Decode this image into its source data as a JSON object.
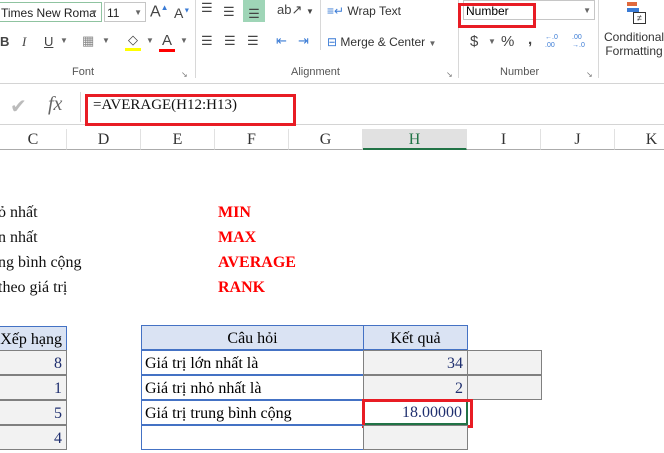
{
  "ribbon": {
    "font_name": "Times New Roma",
    "font_size": "11",
    "bold": "B",
    "italic": "I",
    "underline": "U",
    "font_group": "Font",
    "alignment_group": "Alignment",
    "number_group": "Number",
    "wrap_text": "Wrap Text",
    "merge_center": "Merge & Center",
    "number_format": "Number",
    "currency": "$",
    "percent": "%",
    "comma": ",",
    "increase_decimal": "←.0 .00",
    "decrease_decimal": ".00 →.0",
    "conditional_formatting_1": "Conditional",
    "conditional_formatting_2": "Formatting",
    "colors": {
      "highlight": "#ffff00",
      "font_color": "#ff0000",
      "accent": "#217346"
    }
  },
  "formula_bar": {
    "fx": "fx",
    "formula": "=AVERAGE(H12:H13)"
  },
  "columns": [
    "C",
    "D",
    "E",
    "F",
    "G",
    "H",
    "I",
    "J",
    "K"
  ],
  "notes": [
    {
      "text": "ỏ nhất",
      "func": "MIN"
    },
    {
      "text": "n nhất",
      "func": "MAX"
    },
    {
      "text": "ng bình cộng",
      "func": "AVERAGE"
    },
    {
      "text": " theo giá trị",
      "func": "RANK"
    }
  ],
  "rank_table": {
    "header": "Xếp hạng",
    "values": [
      "8",
      "1",
      "5",
      "4"
    ]
  },
  "qa_table": {
    "headers": [
      "Câu hỏi",
      "Kết quả"
    ],
    "rows": [
      {
        "q": "Giá trị lớn nhất là",
        "a": "34"
      },
      {
        "q": "Giá trị nhỏ nhất là",
        "a": "2"
      },
      {
        "q": "Giá trị trung bình cộng",
        "a": "18.00000"
      },
      {
        "q": "",
        "a": ""
      }
    ]
  }
}
